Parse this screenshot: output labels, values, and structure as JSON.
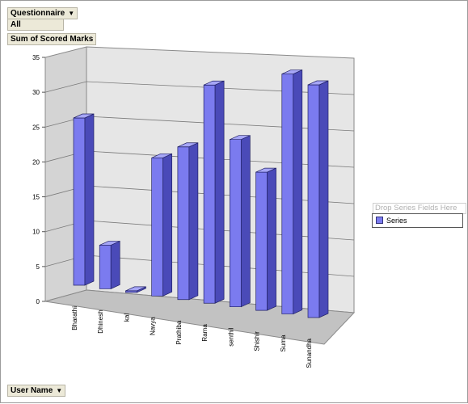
{
  "pivot": {
    "filter_field": "Questionnaire",
    "filter_value": "All",
    "data_field": "Sum of Scored Marks",
    "category_field": "User Name",
    "series_drop_zone": "Drop Series Fields Here"
  },
  "colors": {
    "bar_front": "#7b7bef",
    "bar_side": "#4a4ab8",
    "bar_top": "#a6a6f6",
    "wall": "#d4d4d4",
    "floor": "#c2c2c2"
  },
  "chart_data": {
    "type": "bar",
    "categories": [
      "Bharathi",
      "Dhinesh",
      "kal",
      "Navya",
      "Prathiba",
      "Rama",
      "senthil",
      "Shishir",
      "Suma",
      "Sunandha"
    ],
    "series": [
      {
        "name": "Series",
        "values": [
          23,
          6,
          0,
          19,
          21,
          30,
          23,
          19,
          33,
          32
        ]
      }
    ],
    "yticks": [
      0,
      5,
      10,
      15,
      20,
      25,
      30,
      35
    ],
    "ylim": [
      0,
      35
    ],
    "grid": true,
    "legend": "right"
  }
}
